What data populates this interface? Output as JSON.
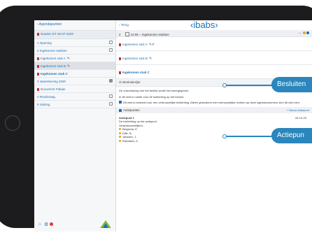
{
  "sidebar": {
    "back_label": "Agendapunten",
    "meeting_title": "Notulen DT 26-07-2020",
    "items": [
      {
        "label": "1 Opening"
      },
      {
        "label": "2 Ingekomen stukken"
      },
      {
        "label": "Ingekomen stuk A"
      },
      {
        "label": "Ingekomen stuk B"
      },
      {
        "label": "Ingekomen stuk C"
      },
      {
        "label": "3 Jaarrekening 2020"
      },
      {
        "label": "Document Fabian"
      },
      {
        "label": "4 Rondvraag"
      },
      {
        "label": "5 Sluiting"
      }
    ]
  },
  "main": {
    "back_label": "Terug",
    "brand": "‹ibabs›",
    "meeting": {
      "number": "2",
      "time": "14:05",
      "title": "Ingekomen stukken"
    },
    "attachments": [
      {
        "label": "Ingekomen stuk A"
      },
      {
        "label": "Ingekomen stuk B"
      },
      {
        "label": "Ingekomen stuk C"
      }
    ],
    "decision_header": "Besluitenlijst",
    "decision_line1": "De omschrijving van het besluit wordt hier weergegeven.",
    "decision_line2": "In dit veld is ruimte voor de toelichting op het besluit.",
    "confidential_note": "Dit veld is bedoeld voor een vertrouwelijke toelichting. Alleen gebruikers met vertrouwelijke rechten op deze agendanummers zien dit veld zien.",
    "actions_header": "Actiepunten",
    "new_action_label": "+ Nieuw Actiepunt",
    "action": {
      "title": "Actiepunt 1",
      "date": "26-10-20",
      "description": "De toelichting op het actiepunt",
      "responsible_label": "Verantwoordelijken:",
      "people": [
        "Bergsma, E.",
        "Dille, B.",
        "Janssen, J.",
        "Ramaken, K."
      ]
    }
  },
  "callouts": {
    "besluiten": "Besluiten",
    "actiepunten": "Actiepun"
  },
  "colors": {
    "accent": "#1e6fb8",
    "callout": "#2a86bd",
    "pdf": "#cc2b2b",
    "logo_green": "#7dbb3e",
    "bezel": "#1c1c1e"
  }
}
